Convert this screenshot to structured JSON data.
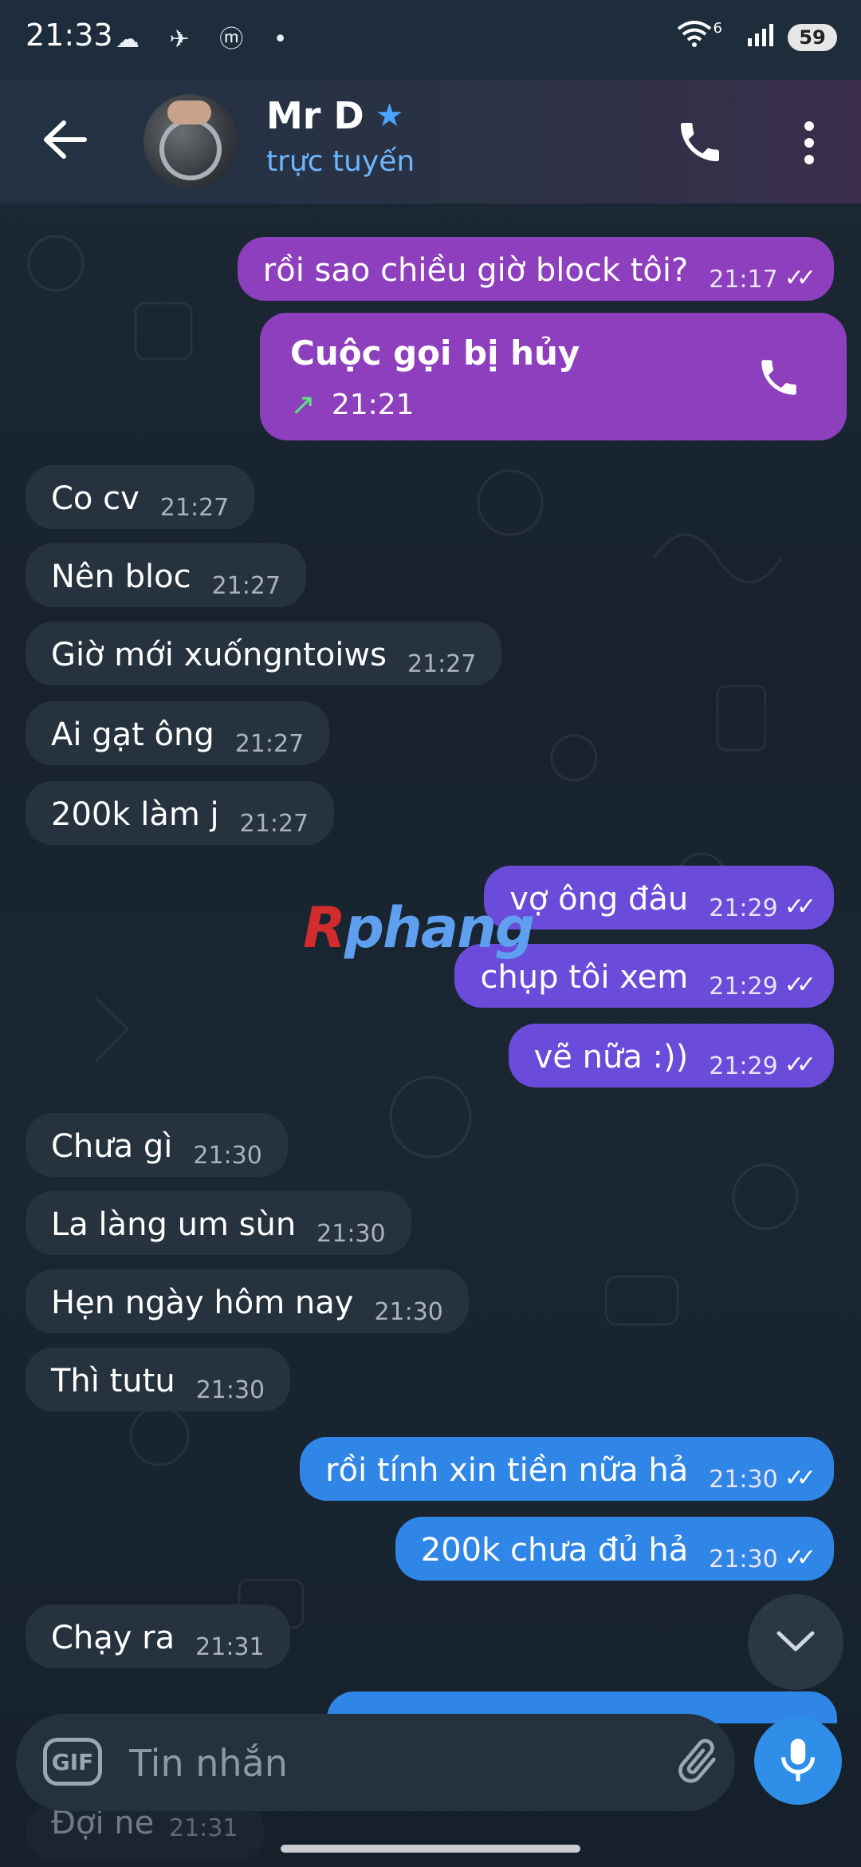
{
  "status_bar": {
    "time": "21:33",
    "icons_left": "☁ ✈ ⓜ •",
    "network": "6",
    "battery": "59"
  },
  "header": {
    "contact_name": "Mr D",
    "status": "trực tuyến",
    "back_icon": "arrow-left",
    "call_icon": "phone",
    "more_icon": "more-vertical"
  },
  "messages": [
    {
      "dir": "out",
      "text": "rồi sao chiều giờ block tôi?",
      "time": "21:17",
      "ticks": "✓✓"
    },
    {
      "dir": "in",
      "text": "Co cv",
      "time": "21:27"
    },
    {
      "dir": "in",
      "text": "Nên bloc",
      "time": "21:27"
    },
    {
      "dir": "in",
      "text": "Giờ mới xuốngntoiws",
      "time": "21:27"
    },
    {
      "dir": "in",
      "text": "Ai gạt ông",
      "time": "21:27"
    },
    {
      "dir": "in",
      "text": "200k làm j",
      "time": "21:27"
    },
    {
      "dir": "out",
      "text": "vợ ông đâu",
      "time": "21:29",
      "ticks": "✓✓"
    },
    {
      "dir": "out",
      "text": "chụp tôi xem",
      "time": "21:29",
      "ticks": "✓✓"
    },
    {
      "dir": "out",
      "text": "vẽ nữa :))",
      "time": "21:29",
      "ticks": "✓✓"
    },
    {
      "dir": "in",
      "text": "Chưa gì",
      "time": "21:30"
    },
    {
      "dir": "in",
      "text": "La làng um sùn",
      "time": "21:30"
    },
    {
      "dir": "in",
      "text": "Hẹn ngày hôm nay",
      "time": "21:30"
    },
    {
      "dir": "in",
      "text": "Thì tutu",
      "time": "21:30"
    },
    {
      "dir": "out",
      "text": "rồi tính xin tiền nữa hả",
      "time": "21:30",
      "ticks": "✓✓"
    },
    {
      "dir": "out",
      "text": "200k chưa đủ hả",
      "time": "21:30",
      "ticks": "✓✓"
    },
    {
      "dir": "in",
      "text": "Chạy ra",
      "time": "21:31"
    }
  ],
  "call_message": {
    "title": "Cuộc gọi bị hủy",
    "time": "21:21",
    "arrow": "↗"
  },
  "watermark": {
    "first": "R",
    "rest": "phang"
  },
  "partial_message": {
    "text": "Đợi ne",
    "time": "21:31"
  },
  "input": {
    "gif_label": "GIF",
    "placeholder": "Tin nhắn"
  },
  "colors": {
    "outgoing_purple": "#8e3fbe",
    "outgoing_violet": "#6b4bd9",
    "outgoing_blue": "#2f86e6",
    "incoming": "#26323e",
    "accent": "#6cb6ff"
  }
}
